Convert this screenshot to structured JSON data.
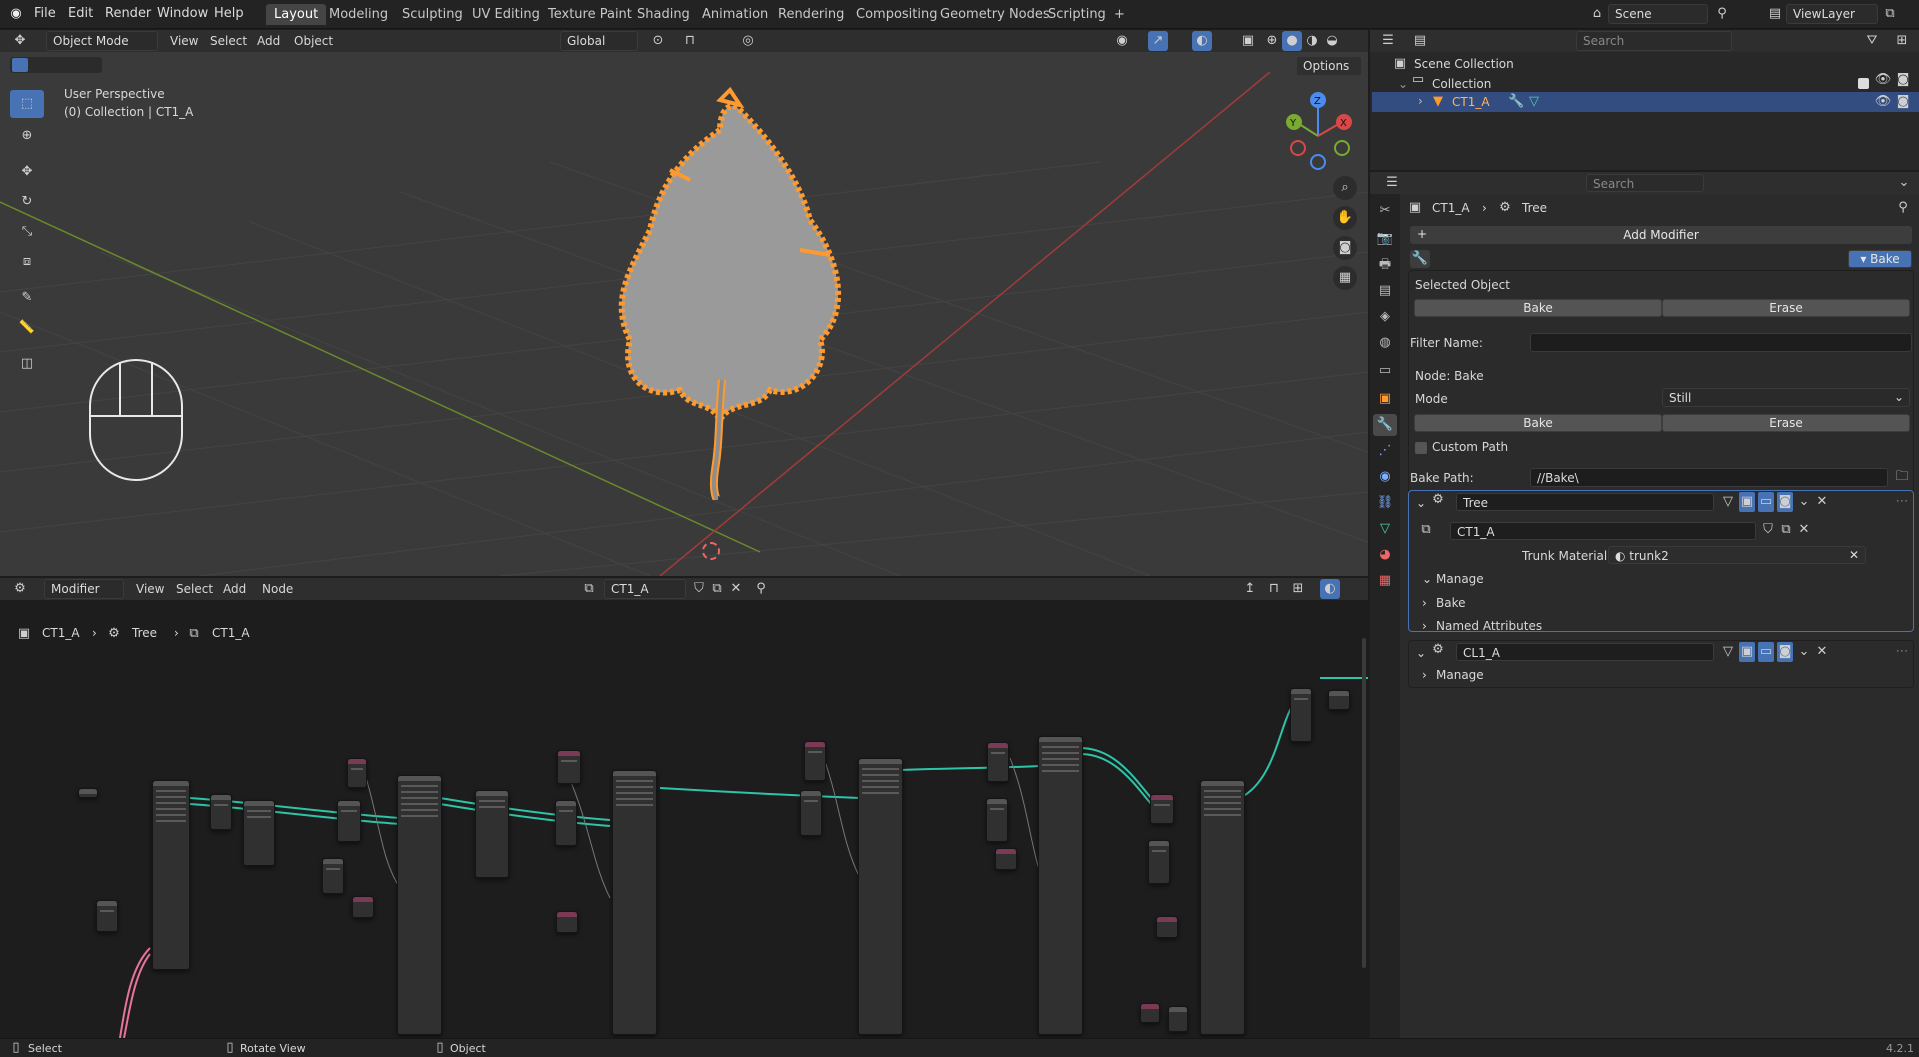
{
  "topbar": {
    "menus": [
      "File",
      "Edit",
      "Render",
      "Window",
      "Help"
    ],
    "workspaces": [
      "Layout",
      "Modeling",
      "Sculpting",
      "UV Editing",
      "Texture Paint",
      "Shading",
      "Animation",
      "Rendering",
      "Compositing",
      "Geometry Nodes",
      "Scripting"
    ],
    "active_workspace": "Layout",
    "add_tab": "+",
    "scene": "Scene",
    "view_layer": "ViewLayer"
  },
  "viewport": {
    "mode": "Object Mode",
    "menus": [
      "View",
      "Select",
      "Add",
      "Object"
    ],
    "transform": "Global",
    "options": "Options",
    "perspective": "User Perspective",
    "collection_info": "(0) Collection | CT1_A",
    "gizmo": {
      "z": "Z",
      "y": "Y",
      "x": "X"
    }
  },
  "node_editor": {
    "type": "Modifier",
    "menus": [
      "View",
      "Select",
      "Add",
      "Node"
    ],
    "tree_name": "CT1_A",
    "breadcrumb": [
      "CT1_A",
      "Tree",
      "CT1_A"
    ]
  },
  "outliner": {
    "search_placeholder": "Search",
    "items": [
      {
        "label": "Scene Collection"
      },
      {
        "label": "Collection"
      },
      {
        "label": "CT1_A"
      }
    ]
  },
  "properties": {
    "search_placeholder": "Search",
    "breadcrumb": [
      "CT1_A",
      "Tree"
    ],
    "add_modifier": "Add Modifier",
    "bake_toggle": "Bake",
    "selected_object_label": "Selected Object",
    "bake": "Bake",
    "erase": "Erase",
    "filter_name_label": "Filter Name:",
    "node_label": "Node:  Bake",
    "mode_label": "Mode",
    "mode_value": "Still",
    "custom_path": "Custom Path",
    "bake_path_label": "Bake Path:",
    "bake_path_value": "//Bake\\",
    "modifier1": {
      "name": "Tree",
      "tree": "CT1_A",
      "trunk_material_label": "Trunk Material",
      "trunk_material_value": "trunk2",
      "manage": "Manage",
      "bake": "Bake",
      "named_attributes": "Named Attributes"
    },
    "modifier2": {
      "name": "CL1_A",
      "manage": "Manage"
    }
  },
  "statusbar": {
    "select": "Select",
    "rotate": "Rotate View",
    "object": "Object",
    "version": "4.2.1"
  },
  "colors": {
    "accent": "#4772b3",
    "selection": "#ff9a2e",
    "header": "#2e2e2e",
    "background": "#1d1d1d"
  }
}
